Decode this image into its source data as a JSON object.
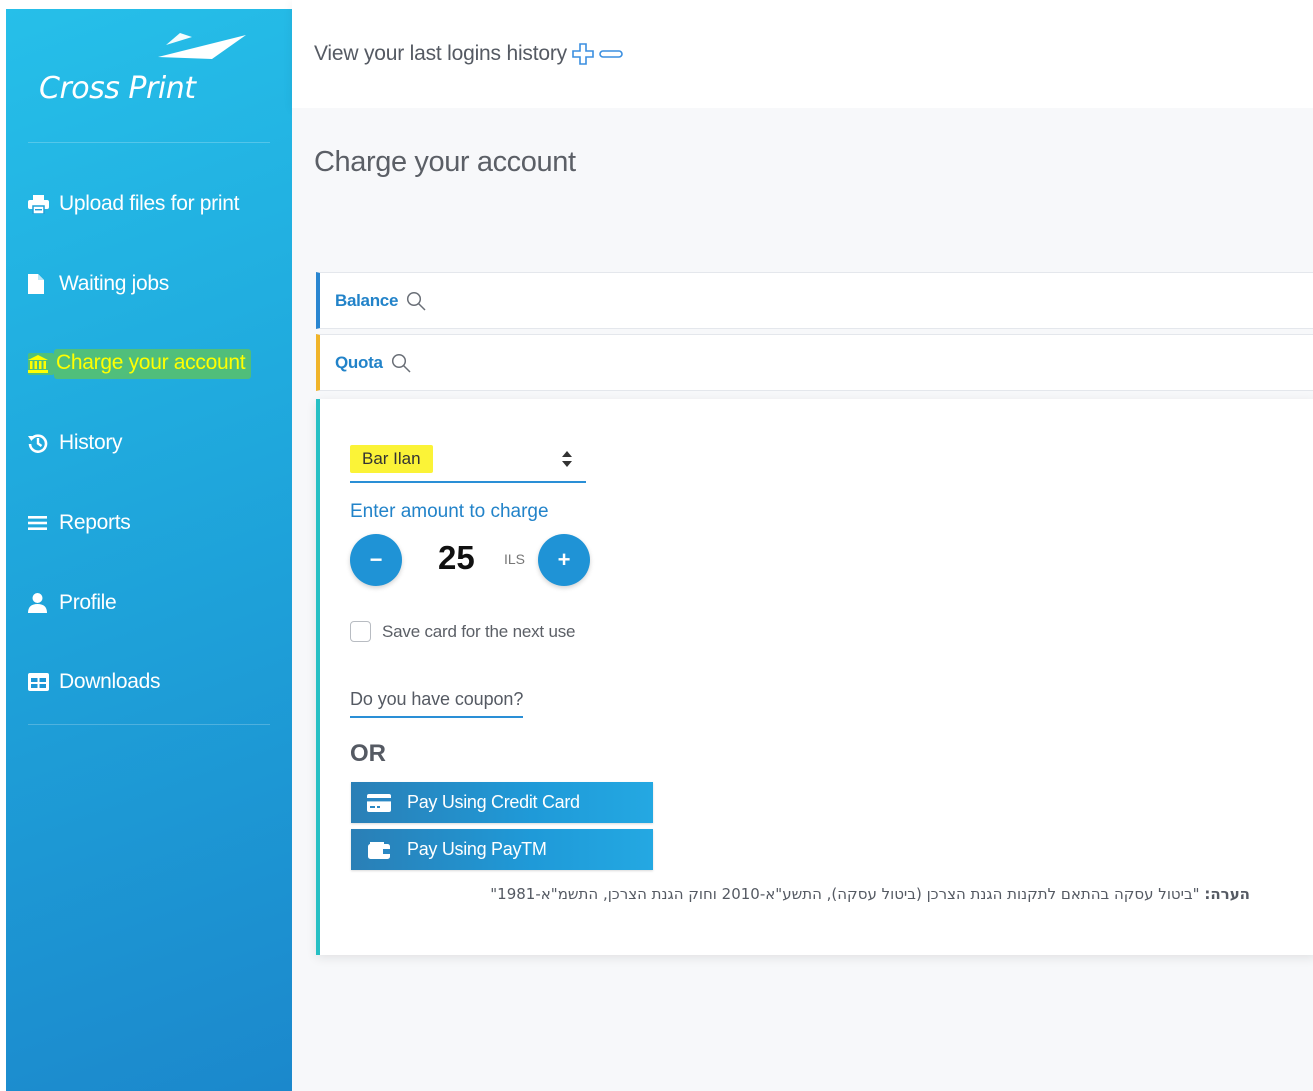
{
  "app": {
    "logo_text": "Cross Print"
  },
  "sidebar": {
    "items": [
      {
        "label": "Upload files for print",
        "icon": "printer-icon"
      },
      {
        "label": "Waiting jobs",
        "icon": "document-icon"
      },
      {
        "label": "Charge your account",
        "icon": "bank-icon",
        "active": true
      },
      {
        "label": "History",
        "icon": "history-icon"
      },
      {
        "label": "Reports",
        "icon": "menu-lines-icon"
      },
      {
        "label": "Profile",
        "icon": "user-icon"
      },
      {
        "label": "Downloads",
        "icon": "table-icon"
      }
    ]
  },
  "header": {
    "login_history_text": "View your last logins history",
    "toggle_icons": [
      "plus-icon",
      "minus-icon"
    ]
  },
  "main": {
    "title": "Charge your account",
    "balance_label": "Balance",
    "quota_label": "Quota",
    "institution_select": "Bar Ilan",
    "amount_label": "Enter amount to charge",
    "amount_value": "25",
    "currency": "ILS",
    "decrement_symbol": "−",
    "increment_symbol": "+",
    "save_card_label": "Save card for the next use",
    "save_card_checked": false,
    "coupon_label": "Do you have coupon?",
    "or_text": "OR",
    "pay_credit_card_label": "Pay Using Credit Card",
    "pay_paytm_label": "Pay Using PayTM",
    "note_prefix": "הערה:",
    "note_text": "\"ביטול עסקה בהתאם לתקנות הגנת הצרכן (ביטול עסקה), התשע\"א-2010 וחוק הגנת הצרכן, התשמ\"א-1981\""
  },
  "colors": {
    "sidebar_gradient_start": "#26bfe9",
    "sidebar_gradient_end": "#1b88cc",
    "accent_blue": "#2283c9",
    "highlight_yellow": "#fbf337",
    "active_highlight_green": "#78cd28",
    "quota_border": "#f0b429",
    "card_border": "#27c0c4"
  }
}
